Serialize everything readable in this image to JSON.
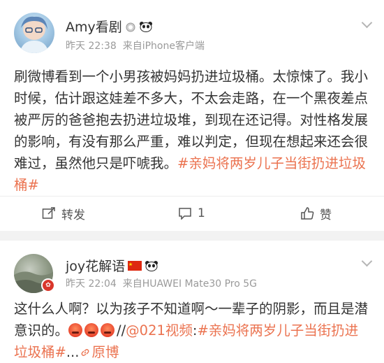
{
  "post1": {
    "username": "Amy看剧",
    "badges": [
      "medal-icon",
      "panda-icon"
    ],
    "time": "昨天 22:38",
    "source": "来自iPhone客户端",
    "body_text": "刷微博看到一个小男孩被妈妈扔进垃圾桶。太惊悚了。我小时候，估计跟这娃差不多大，不太会走路，在一个黑夜差点被严厉的爸爸抱去扔进垃圾堆，到现在还记得。对性格发展的影响，有没有那么严重，难以判定，但现在想起来还会很难过，虽然他只是吓唬我。",
    "hashtag": "#亲妈将两岁儿子当街扔进垃圾桶#",
    "actions": {
      "repost_label": "转发",
      "comment_count": "1",
      "like_label": "赞"
    }
  },
  "post2": {
    "username": "joy花解语",
    "badges": [
      "china-flag-icon",
      "panda-icon"
    ],
    "time": "昨天 22:04",
    "source": "来自HUAWEI Mate30 Pro 5G",
    "body_text": "这什么人啊？以为孩子不知道啊～一辈子的阴影，而且是潜意识的。",
    "emoji_count": 3,
    "repost_prefix": "//",
    "mention": "@021视频",
    "colon": ":",
    "hashtag": "#亲妈将两岁儿子当街扔进垃圾桶#",
    "ellipsis": "...",
    "original_link": "原博"
  },
  "colors": {
    "accent": "#eb7350",
    "text": "#333333",
    "meta": "#9a9a9a",
    "separator": "#f2f2f2"
  }
}
